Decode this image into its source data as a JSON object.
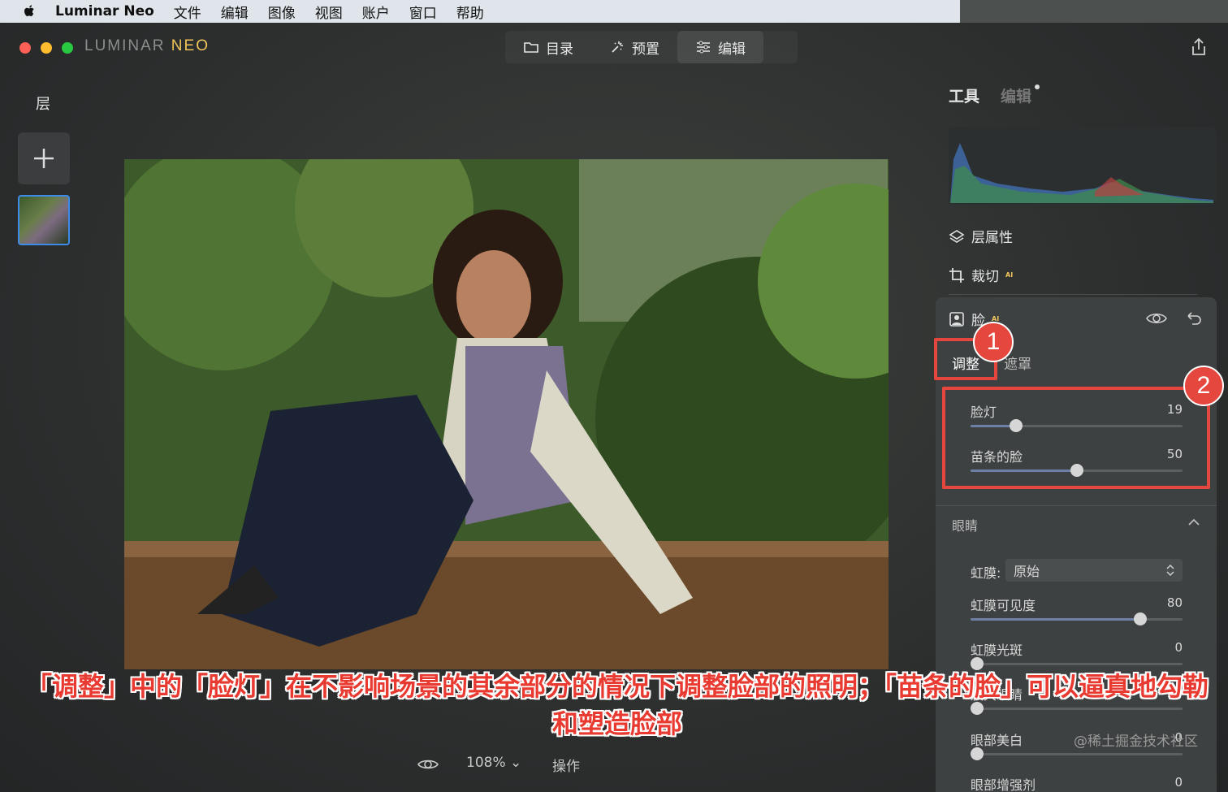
{
  "menubar": {
    "app_name": "Luminar Neo",
    "items": [
      "文件",
      "编辑",
      "图像",
      "视图",
      "账户",
      "窗口",
      "帮助"
    ]
  },
  "window": {
    "brand_main": "LUMINAR ",
    "brand_accent": "NEO",
    "tabs": [
      {
        "label": "目录",
        "icon": "folder-icon"
      },
      {
        "label": "预置",
        "icon": "sparkle-icon"
      },
      {
        "label": "编辑",
        "icon": "sliders-icon"
      }
    ],
    "active_tab": "编辑"
  },
  "layers": {
    "title": "层"
  },
  "bottom_bar": {
    "zoom": "108%",
    "ops_label": "操作"
  },
  "right_panel": {
    "tab_tools": "工具",
    "tab_edits": "编辑",
    "layer_properties": "层属性",
    "crop": "裁切",
    "ai_badge": "AI",
    "face": {
      "title": "脸",
      "subtab_adjust": "调整",
      "subtab_mask": "遮罩",
      "sliders": [
        {
          "label": "脸灯",
          "value": "19",
          "fraction": 0.215
        },
        {
          "label": "苗条的脸",
          "value": "50",
          "fraction": 0.5
        }
      ]
    },
    "eyes": {
      "title": "眼睛",
      "iris_label": "虹膜:",
      "iris_value": "原始",
      "sliders": [
        {
          "label": "虹膜可见度",
          "value": "80",
          "fraction": 0.8
        },
        {
          "label": "虹膜光斑",
          "value": "0",
          "fraction": 0.03
        },
        {
          "label": "放大眼睛",
          "value": "0",
          "fraction": 0.03
        },
        {
          "label": "眼部美白",
          "value": "0",
          "fraction": 0.03
        },
        {
          "label": "眼部增强剂",
          "value": "0",
          "fraction": 0.03
        }
      ]
    }
  },
  "annotations": {
    "callout_1": "1",
    "callout_2": "2",
    "caption": "「调整」中的「脸灯」在不影响场景的其余部分的情况下调整脸部的照明；「苗条的脸」可以逼真地勾勒和塑造脸部",
    "watermark": "@稀土掘金技术社区"
  },
  "colors": {
    "accent_blue": "#3d8be8",
    "annotation_red": "#e5463d",
    "brand_gold": "#f0c55a"
  }
}
